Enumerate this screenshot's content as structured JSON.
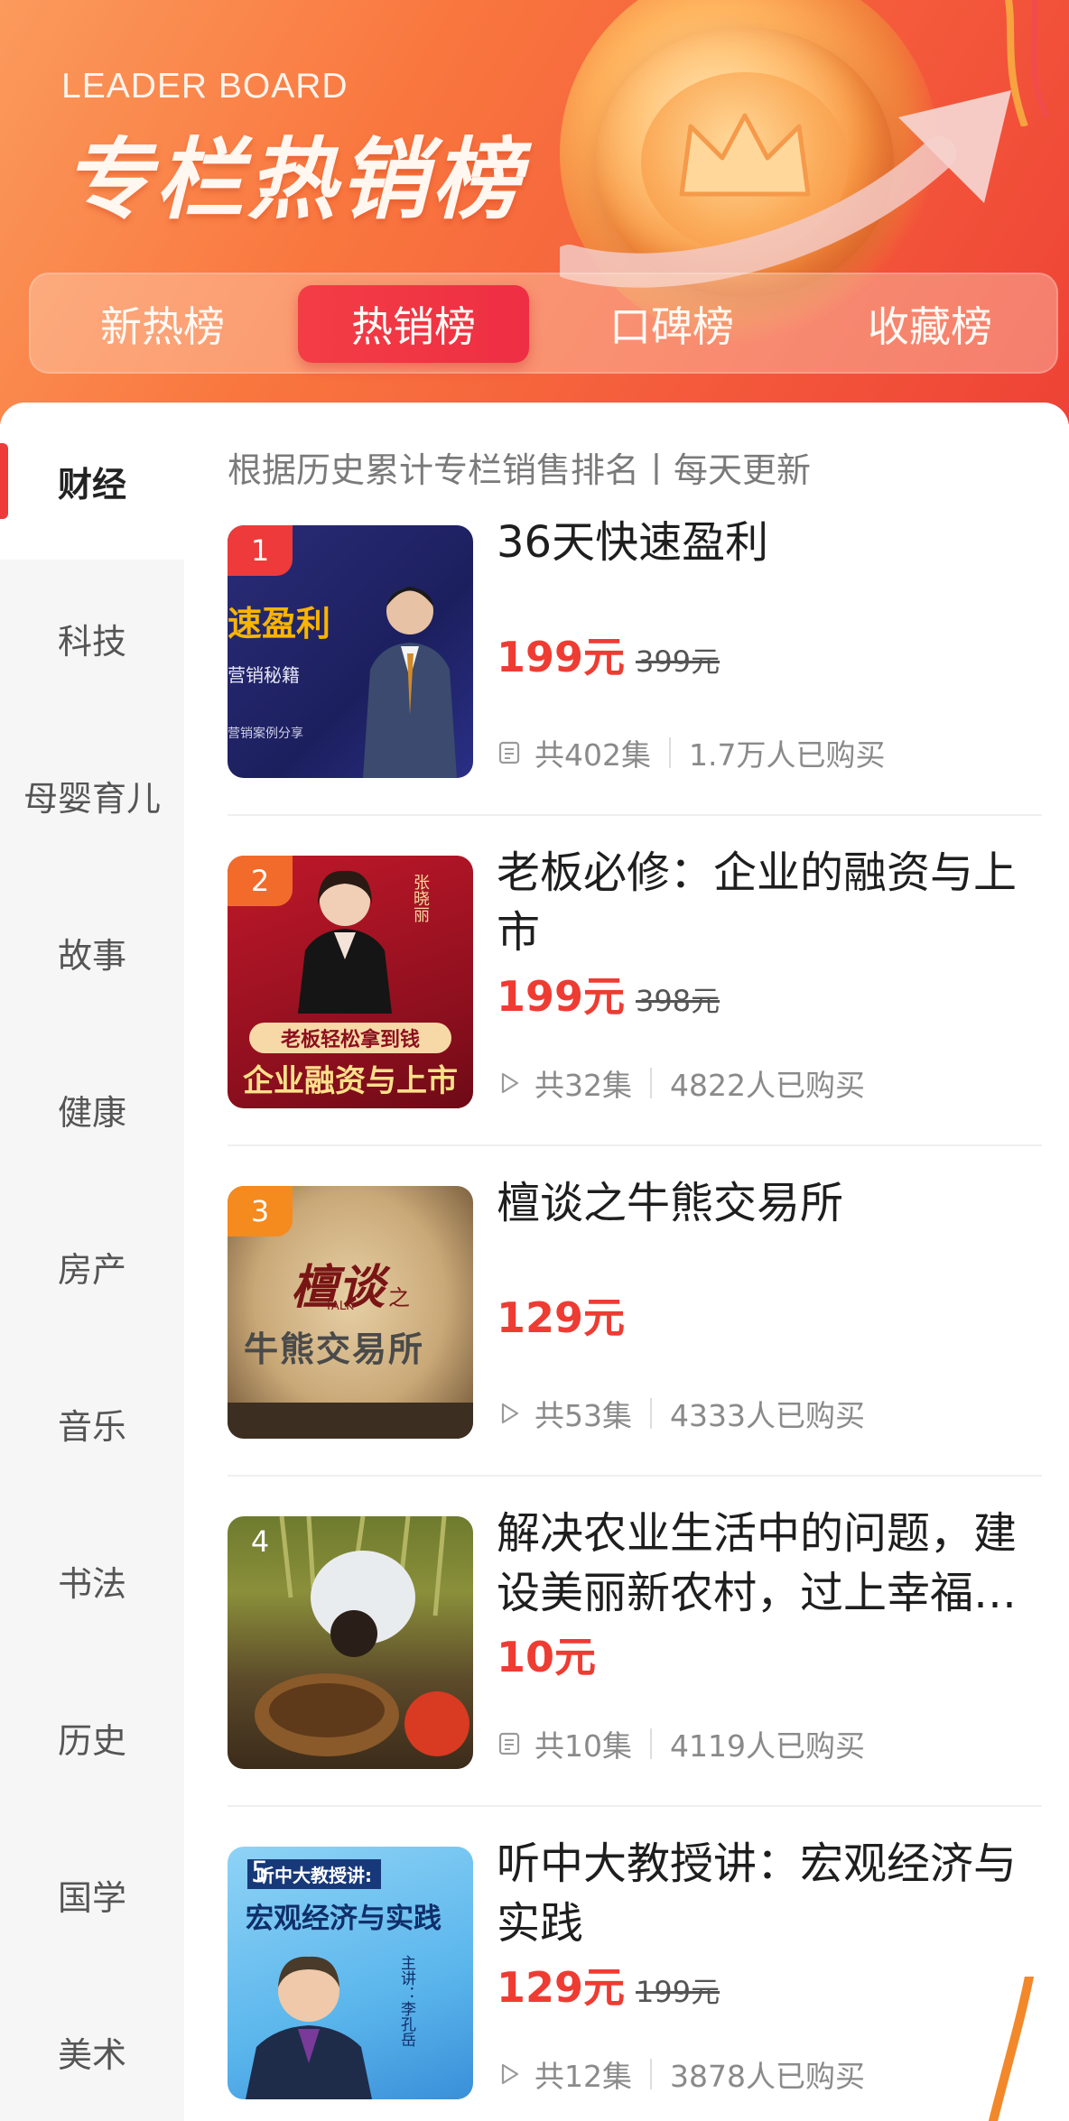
{
  "header": {
    "subtitle_en": "LEADER BOARD",
    "title": "专栏热销榜",
    "tabs": [
      {
        "label": "新热榜",
        "active": false
      },
      {
        "label": "热销榜",
        "active": true
      },
      {
        "label": "口碑榜",
        "active": false
      },
      {
        "label": "收藏榜",
        "active": false
      }
    ]
  },
  "sidebar": {
    "items": [
      {
        "label": "财经",
        "active": true
      },
      {
        "label": "科技",
        "active": false
      },
      {
        "label": "母婴育儿",
        "active": false
      },
      {
        "label": "故事",
        "active": false
      },
      {
        "label": "健康",
        "active": false
      },
      {
        "label": "房产",
        "active": false
      },
      {
        "label": "音乐",
        "active": false
      },
      {
        "label": "书法",
        "active": false
      },
      {
        "label": "历史",
        "active": false
      },
      {
        "label": "国学",
        "active": false
      },
      {
        "label": "美术",
        "active": false
      }
    ]
  },
  "main": {
    "subtitle": "根据历史累计专栏销售排名丨每天更新",
    "items": [
      {
        "rank": "1",
        "title": "36天快速盈利",
        "price": "199元",
        "original_price": "399元",
        "episodes": "共402集",
        "buyers": "1.7万人已购买",
        "icon": "document-icon",
        "thumb_texts": [
          "速盈利",
          "营销秘籍",
          "营销案例分享"
        ]
      },
      {
        "rank": "2",
        "title": "老板必修：企业的融资与上市",
        "price": "199元",
        "original_price": "398元",
        "episodes": "共32集",
        "buyers": "4822人已购买",
        "icon": "play-icon",
        "thumb_texts": [
          "老板轻松拿到钱",
          "企业融资与上市",
          "张晓丽"
        ]
      },
      {
        "rank": "3",
        "title": "檀谈之牛熊交易所",
        "price": "129元",
        "original_price": "",
        "episodes": "共53集",
        "buyers": "4333人已购买",
        "icon": "play-icon",
        "thumb_texts": [
          "檀谈",
          "TALK",
          "之",
          "牛熊交易所"
        ]
      },
      {
        "rank": "4",
        "title": "解决农业生活中的问题，建设美丽新农村，过上幸福…",
        "price": "10元",
        "original_price": "",
        "episodes": "共10集",
        "buyers": "4119人已购买",
        "icon": "document-icon",
        "thumb_texts": []
      },
      {
        "rank": "5",
        "title": "听中大教授讲：宏观经济与实践",
        "price": "129元",
        "original_price": "199元",
        "episodes": "共12集",
        "buyers": "3878人已购买",
        "icon": "play-icon",
        "thumb_texts": [
          "听中大教授讲:",
          "宏观经济与实践",
          "主讲：李孔岳"
        ]
      }
    ]
  },
  "colors": {
    "accent": "#ee3c33",
    "active_tab": "#f03a44",
    "banner_from": "#fb9a5c",
    "banner_to": "#ee4236"
  }
}
